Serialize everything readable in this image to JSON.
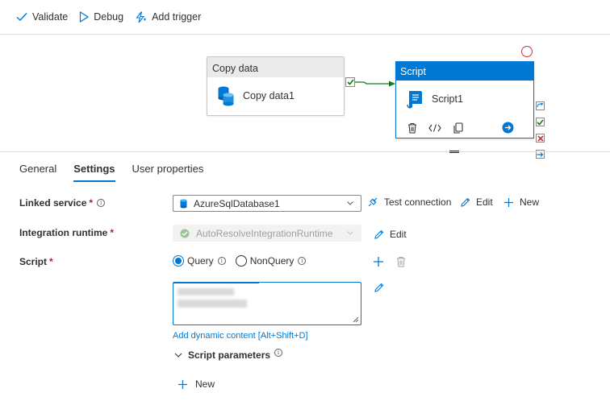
{
  "toolbar": {
    "validate_label": "Validate",
    "debug_label": "Debug",
    "add_trigger_label": "Add trigger"
  },
  "canvas": {
    "copy_node": {
      "header": "Copy data",
      "name": "Copy data1"
    },
    "script_node": {
      "header": "Script",
      "name": "Script1"
    }
  },
  "tabs": [
    {
      "label": "General"
    },
    {
      "label": "Settings",
      "active": true
    },
    {
      "label": "User properties"
    }
  ],
  "form": {
    "linked_service": {
      "label": "Linked service",
      "required": "*",
      "value": "AzureSqlDatabase1",
      "test_connection": "Test connection",
      "edit": "Edit",
      "new": "New"
    },
    "integration_runtime": {
      "label": "Integration runtime",
      "required": "*",
      "value": "AutoResolveIntegrationRuntime",
      "edit": "Edit"
    },
    "script": {
      "label": "Script",
      "required": "*",
      "option_query": "Query",
      "option_nonquery": "NonQuery",
      "selected": "Query",
      "dynamic_content_link": "Add dynamic content [Alt+Shift+D]",
      "parameters_label": "Script parameters",
      "new_label": "New"
    }
  },
  "colors": {
    "accent": "#0078d4",
    "success": "#107c10",
    "error": "#d13438",
    "required": "#a4262c"
  },
  "icons": [
    "check-icon",
    "play-icon",
    "lightning-icon",
    "database-icon",
    "script-icon",
    "trash-icon",
    "code-icon",
    "copy-icon",
    "arrow-right-icon",
    "plug-icon",
    "pencil-icon",
    "plus-icon",
    "chevron-down-icon",
    "info-icon"
  ]
}
